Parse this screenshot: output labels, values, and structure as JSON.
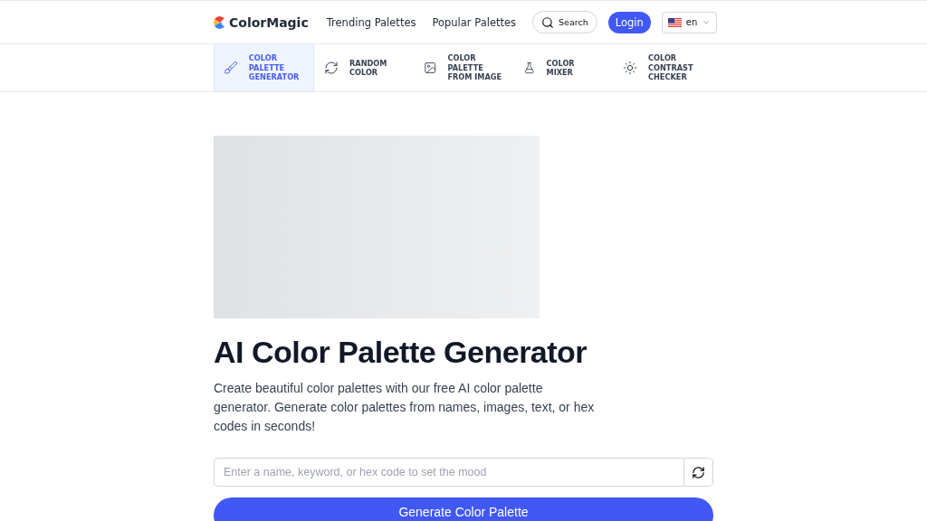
{
  "header": {
    "brand": "ColorMagic",
    "links": [
      "Trending Palettes",
      "Popular Palettes"
    ],
    "search_label": "Search",
    "login_label": "Login",
    "language": "en"
  },
  "tools": [
    {
      "label": "COLOR PALETTE GENERATOR",
      "selected": true
    },
    {
      "label": "RANDOM COLOR",
      "selected": false
    },
    {
      "label": "COLOR PALETTE FROM IMAGE",
      "selected": false
    },
    {
      "label": "COLOR MIXER",
      "selected": false
    },
    {
      "label": "COLOR CONTRAST CHECKER",
      "selected": false
    }
  ],
  "hero": {
    "title": "AI Color Palette Generator",
    "description": "Create beautiful color palettes with our free AI color palette generator. Generate color palettes from names, images, text, or hex codes in seconds!"
  },
  "prompt": {
    "placeholder": "Enter a name, keyword, or hex code to set the mood",
    "button": "Generate Color Palette"
  }
}
